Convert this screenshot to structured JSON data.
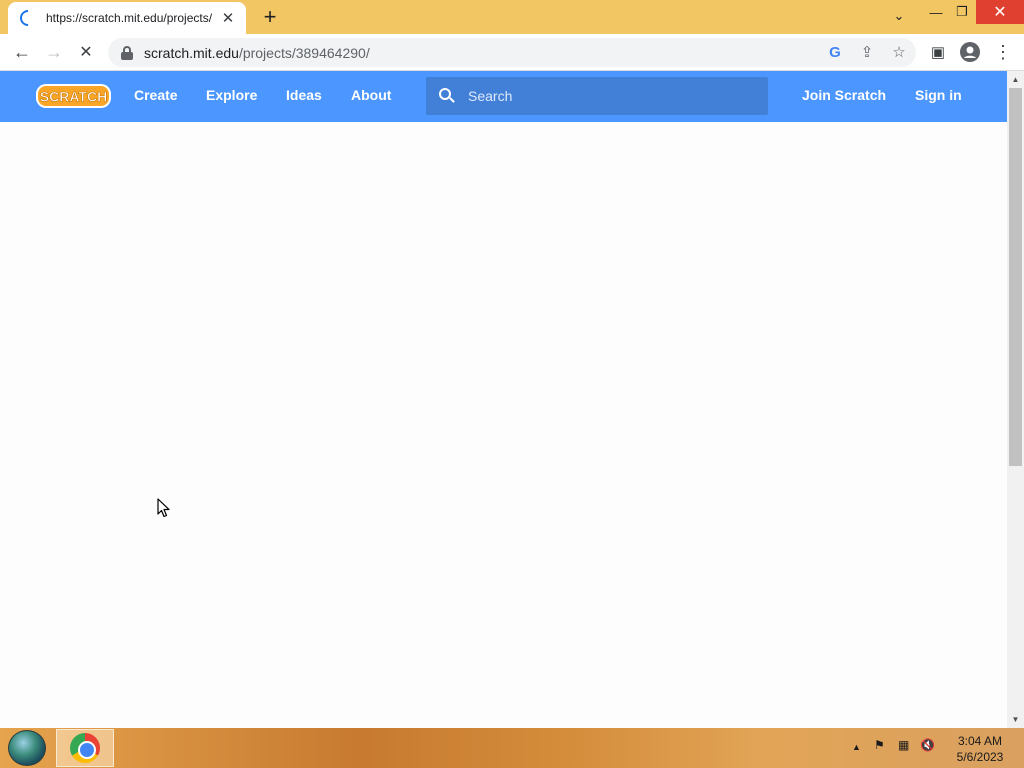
{
  "browser": {
    "tab": {
      "title": "https://scratch.mit.edu/projects/",
      "close_glyph": "✕"
    },
    "new_tab_glyph": "+",
    "window_controls": {
      "dropdown": "⌄",
      "minimize": "—",
      "restore": "❐",
      "close": "✕"
    },
    "toolbar": {
      "back_glyph": "←",
      "forward_glyph": "→",
      "reload_glyph": "✕",
      "menu_glyph": "⋮"
    },
    "omnibox": {
      "host": "scratch.mit.edu",
      "path": "/projects/389464290/"
    },
    "omnibox_icons": [
      "google-icon",
      "share-icon",
      "star-icon"
    ],
    "omnibox_glyphs": {
      "google": "G",
      "share": "⇪",
      "star": "☆"
    },
    "side_panel_glyph": "▣",
    "profile_glyph": "●"
  },
  "scratch": {
    "logo_text": "SCRATCH",
    "nav": {
      "create": "Create",
      "explore": "Explore",
      "ideas": "Ideas",
      "about": "About"
    },
    "search": {
      "placeholder": "Search"
    },
    "join": "Join Scratch",
    "sign_in": "Sign in",
    "colors": {
      "nav": "#4c97ff",
      "search": "#4280d7",
      "logo": "#f9a526"
    }
  },
  "taskbar": {
    "tray_glyphs": {
      "show_hidden": "▲",
      "flag": "⚑",
      "network": "▦",
      "volume": "🔇"
    },
    "time": "3:04 AM",
    "date": "5/6/2023"
  }
}
